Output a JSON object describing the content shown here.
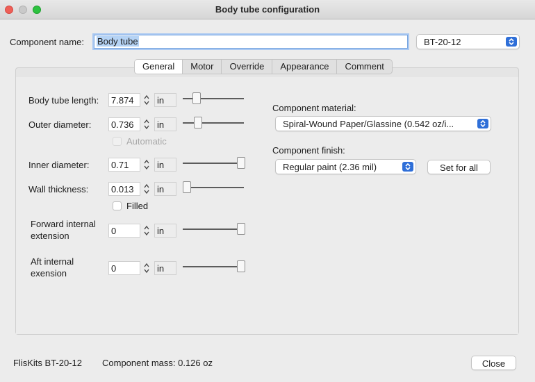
{
  "window": {
    "title": "Body tube configuration"
  },
  "header": {
    "name_label": "Component name:",
    "name_value": "Body tube",
    "preset_value": "BT-20-12"
  },
  "tabs": [
    {
      "label": "General",
      "active": true
    },
    {
      "label": "Motor",
      "active": false
    },
    {
      "label": "Override",
      "active": false
    },
    {
      "label": "Appearance",
      "active": false
    },
    {
      "label": "Comment",
      "active": false
    }
  ],
  "fields": {
    "length": {
      "label": "Body tube length:",
      "value": "7.874",
      "unit": "in"
    },
    "outer": {
      "label": "Outer diameter:",
      "value": "0.736",
      "unit": "in"
    },
    "automatic": {
      "label": "Automatic",
      "checked": false
    },
    "inner": {
      "label": "Inner diameter:",
      "value": "0.71",
      "unit": "in"
    },
    "wall": {
      "label": "Wall thickness:",
      "value": "0.013",
      "unit": "in"
    },
    "filled": {
      "label": "Filled",
      "checked": false
    },
    "fwd_ext": {
      "label_line1": "Forward internal",
      "label_line2": "extension",
      "value": "0",
      "unit": "in"
    },
    "aft_ext": {
      "label_line1": "Aft internal",
      "label_line2": "exension",
      "value": "0",
      "unit": "in"
    }
  },
  "material": {
    "label": "Component material:",
    "value": "Spiral-Wound Paper/Glassine (0.542 oz/i..."
  },
  "finish": {
    "label": "Component finish:",
    "value": "Regular paint (2.36 mil)",
    "set_all_label": "Set for all"
  },
  "footer": {
    "preset_name": "FlisKits BT-20-12",
    "mass": "Component mass: 0.126 oz",
    "close_label": "Close"
  }
}
